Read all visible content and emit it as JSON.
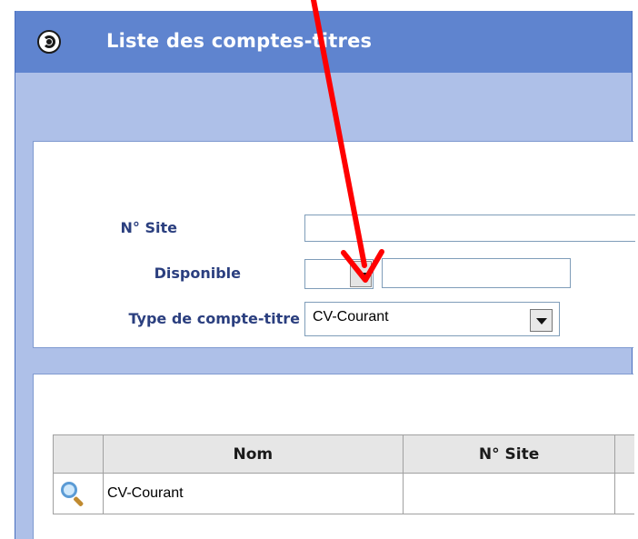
{
  "window": {
    "title": "Liste des comptes-titres"
  },
  "filters": {
    "site_label": "N° Site",
    "site_value": "",
    "disponible_label": "Disponible",
    "disponible_value": "",
    "type_label": "Type de compte-titre",
    "type_value": "CV-Courant"
  },
  "table": {
    "columns": [
      "",
      "Nom",
      "N° Site",
      ""
    ],
    "rows": [
      {
        "icon": "search-icon",
        "nom": "CV-Courant",
        "site": ""
      }
    ]
  },
  "annotation": {
    "arrow_color": "#ff0000"
  },
  "colors": {
    "titlebar": "#5f84cf",
    "label": "#2b3f7f",
    "background": "#aec0e8"
  }
}
